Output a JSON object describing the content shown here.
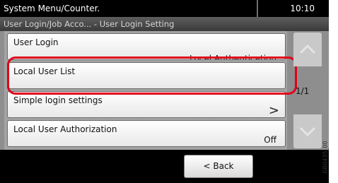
{
  "status_bar": {
    "system_label": "System Menu/Counter.",
    "time": "10:10"
  },
  "breadcrumb": "User Login/Job Acco... - User Login Setting",
  "menu_items": [
    {
      "label": "User Login",
      "value": "Local Authentication"
    },
    {
      "label": "Local User List"
    },
    {
      "label": "Simple login settings",
      "arrow": ">"
    },
    {
      "label": "Local User Authorization",
      "value": "Off"
    }
  ],
  "pager": "1/1",
  "back_button": "< Back",
  "image_code": "GB0435_00",
  "colors": {
    "highlight": "#e0001a",
    "status_bar": "#000000",
    "panel": "#8e8e8e"
  }
}
